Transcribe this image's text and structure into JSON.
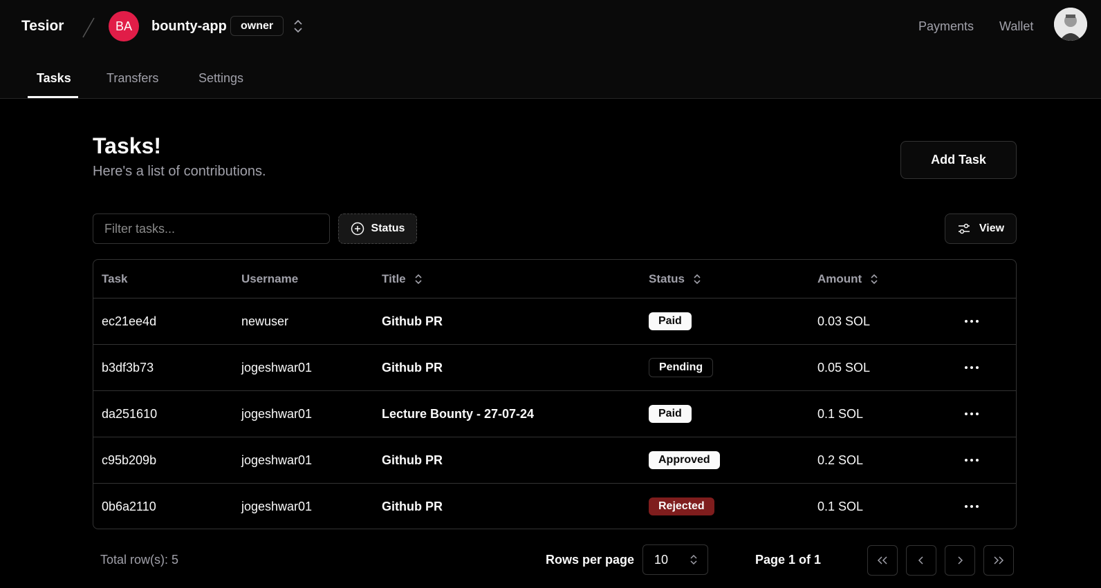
{
  "header": {
    "brand": "Tesior",
    "app_initials": "BA",
    "app_name": "bounty-app",
    "role": "owner",
    "links": [
      "Payments",
      "Wallet"
    ]
  },
  "tabs": [
    {
      "label": "Tasks",
      "active": true
    },
    {
      "label": "Transfers",
      "active": false
    },
    {
      "label": "Settings",
      "active": false
    }
  ],
  "page": {
    "title": "Tasks!",
    "subtitle": "Here's a list of contributions.",
    "add_label": "Add Task"
  },
  "toolbar": {
    "filter_placeholder": "Filter tasks...",
    "status_label": "Status",
    "view_label": "View"
  },
  "table": {
    "columns": [
      "Task",
      "Username",
      "Title",
      "Status",
      "Amount"
    ],
    "rows": [
      {
        "task": "ec21ee4d",
        "username": "newuser",
        "title": "Github PR",
        "status": "Paid",
        "amount": "0.03 SOL"
      },
      {
        "task": "b3df3b73",
        "username": "jogeshwar01",
        "title": "Github PR",
        "status": "Pending",
        "amount": "0.05 SOL"
      },
      {
        "task": "da251610",
        "username": "jogeshwar01",
        "title": "Lecture Bounty - 27-07-24",
        "status": "Paid",
        "amount": "0.1 SOL"
      },
      {
        "task": "c95b209b",
        "username": "jogeshwar01",
        "title": "Github PR",
        "status": "Approved",
        "amount": "0.2 SOL"
      },
      {
        "task": "0b6a2110",
        "username": "jogeshwar01",
        "title": "Github PR",
        "status": "Rejected",
        "amount": "0.1 SOL"
      }
    ]
  },
  "footer": {
    "total": "Total row(s): 5",
    "rows_per_page_label": "Rows per page",
    "rows_per_page": "10",
    "page_info": "Page 1 of 1"
  },
  "colors": {
    "background": "#000000",
    "avatar": "#e11d48",
    "rejected": "#7f1d1d"
  }
}
